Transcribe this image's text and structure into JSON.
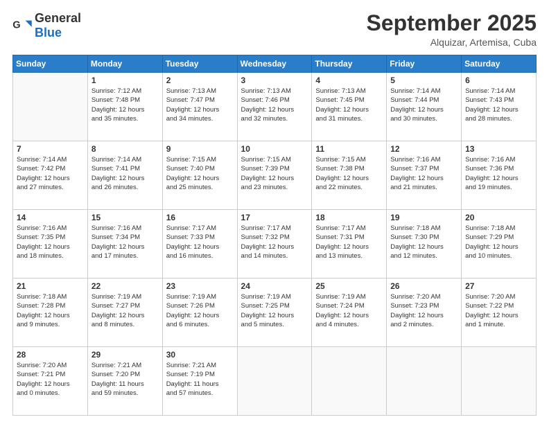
{
  "header": {
    "logo_general": "General",
    "logo_blue": "Blue",
    "month": "September 2025",
    "location": "Alquizar, Artemisa, Cuba"
  },
  "weekdays": [
    "Sunday",
    "Monday",
    "Tuesday",
    "Wednesday",
    "Thursday",
    "Friday",
    "Saturday"
  ],
  "weeks": [
    [
      {
        "day": "",
        "info": ""
      },
      {
        "day": "1",
        "info": "Sunrise: 7:12 AM\nSunset: 7:48 PM\nDaylight: 12 hours\nand 35 minutes."
      },
      {
        "day": "2",
        "info": "Sunrise: 7:13 AM\nSunset: 7:47 PM\nDaylight: 12 hours\nand 34 minutes."
      },
      {
        "day": "3",
        "info": "Sunrise: 7:13 AM\nSunset: 7:46 PM\nDaylight: 12 hours\nand 32 minutes."
      },
      {
        "day": "4",
        "info": "Sunrise: 7:13 AM\nSunset: 7:45 PM\nDaylight: 12 hours\nand 31 minutes."
      },
      {
        "day": "5",
        "info": "Sunrise: 7:14 AM\nSunset: 7:44 PM\nDaylight: 12 hours\nand 30 minutes."
      },
      {
        "day": "6",
        "info": "Sunrise: 7:14 AM\nSunset: 7:43 PM\nDaylight: 12 hours\nand 28 minutes."
      }
    ],
    [
      {
        "day": "7",
        "info": "Sunrise: 7:14 AM\nSunset: 7:42 PM\nDaylight: 12 hours\nand 27 minutes."
      },
      {
        "day": "8",
        "info": "Sunrise: 7:14 AM\nSunset: 7:41 PM\nDaylight: 12 hours\nand 26 minutes."
      },
      {
        "day": "9",
        "info": "Sunrise: 7:15 AM\nSunset: 7:40 PM\nDaylight: 12 hours\nand 25 minutes."
      },
      {
        "day": "10",
        "info": "Sunrise: 7:15 AM\nSunset: 7:39 PM\nDaylight: 12 hours\nand 23 minutes."
      },
      {
        "day": "11",
        "info": "Sunrise: 7:15 AM\nSunset: 7:38 PM\nDaylight: 12 hours\nand 22 minutes."
      },
      {
        "day": "12",
        "info": "Sunrise: 7:16 AM\nSunset: 7:37 PM\nDaylight: 12 hours\nand 21 minutes."
      },
      {
        "day": "13",
        "info": "Sunrise: 7:16 AM\nSunset: 7:36 PM\nDaylight: 12 hours\nand 19 minutes."
      }
    ],
    [
      {
        "day": "14",
        "info": "Sunrise: 7:16 AM\nSunset: 7:35 PM\nDaylight: 12 hours\nand 18 minutes."
      },
      {
        "day": "15",
        "info": "Sunrise: 7:16 AM\nSunset: 7:34 PM\nDaylight: 12 hours\nand 17 minutes."
      },
      {
        "day": "16",
        "info": "Sunrise: 7:17 AM\nSunset: 7:33 PM\nDaylight: 12 hours\nand 16 minutes."
      },
      {
        "day": "17",
        "info": "Sunrise: 7:17 AM\nSunset: 7:32 PM\nDaylight: 12 hours\nand 14 minutes."
      },
      {
        "day": "18",
        "info": "Sunrise: 7:17 AM\nSunset: 7:31 PM\nDaylight: 12 hours\nand 13 minutes."
      },
      {
        "day": "19",
        "info": "Sunrise: 7:18 AM\nSunset: 7:30 PM\nDaylight: 12 hours\nand 12 minutes."
      },
      {
        "day": "20",
        "info": "Sunrise: 7:18 AM\nSunset: 7:29 PM\nDaylight: 12 hours\nand 10 minutes."
      }
    ],
    [
      {
        "day": "21",
        "info": "Sunrise: 7:18 AM\nSunset: 7:28 PM\nDaylight: 12 hours\nand 9 minutes."
      },
      {
        "day": "22",
        "info": "Sunrise: 7:19 AM\nSunset: 7:27 PM\nDaylight: 12 hours\nand 8 minutes."
      },
      {
        "day": "23",
        "info": "Sunrise: 7:19 AM\nSunset: 7:26 PM\nDaylight: 12 hours\nand 6 minutes."
      },
      {
        "day": "24",
        "info": "Sunrise: 7:19 AM\nSunset: 7:25 PM\nDaylight: 12 hours\nand 5 minutes."
      },
      {
        "day": "25",
        "info": "Sunrise: 7:19 AM\nSunset: 7:24 PM\nDaylight: 12 hours\nand 4 minutes."
      },
      {
        "day": "26",
        "info": "Sunrise: 7:20 AM\nSunset: 7:23 PM\nDaylight: 12 hours\nand 2 minutes."
      },
      {
        "day": "27",
        "info": "Sunrise: 7:20 AM\nSunset: 7:22 PM\nDaylight: 12 hours\nand 1 minute."
      }
    ],
    [
      {
        "day": "28",
        "info": "Sunrise: 7:20 AM\nSunset: 7:21 PM\nDaylight: 12 hours\nand 0 minutes."
      },
      {
        "day": "29",
        "info": "Sunrise: 7:21 AM\nSunset: 7:20 PM\nDaylight: 11 hours\nand 59 minutes."
      },
      {
        "day": "30",
        "info": "Sunrise: 7:21 AM\nSunset: 7:19 PM\nDaylight: 11 hours\nand 57 minutes."
      },
      {
        "day": "",
        "info": ""
      },
      {
        "day": "",
        "info": ""
      },
      {
        "day": "",
        "info": ""
      },
      {
        "day": "",
        "info": ""
      }
    ]
  ]
}
